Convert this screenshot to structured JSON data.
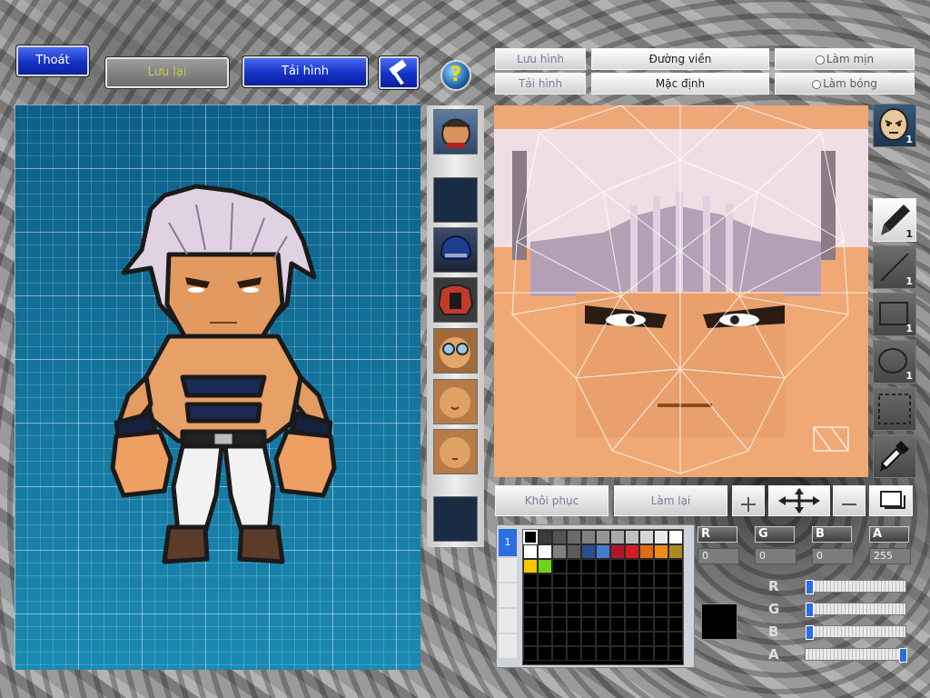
{
  "top_bar": {
    "exit": "Thoát",
    "save": "Lưu lại",
    "reload": "Tải hình",
    "help_symbol": "?"
  },
  "editor_bar": {
    "save": "Lưu hình",
    "reload": "Tải hình",
    "outline": "Đường viền",
    "default": "Mặc định",
    "smooth": "Làm mịn",
    "shade": "Làm bóng"
  },
  "tools": {
    "face_count": "1",
    "pen_count": "1",
    "line_count": "1",
    "rect_count": "1",
    "ellipse_count": "1"
  },
  "bottom_bar": {
    "restore": "Khôi phục",
    "redo": "Làm lại"
  },
  "palette": {
    "layer_index": "1",
    "colors": [
      "#000000",
      "#3a3a3a",
      "#545454",
      "#6a6a6a",
      "#808080",
      "#959595",
      "#aaaaaa",
      "#c0c0c0",
      "#d5d5d5",
      "#eaeaea",
      "#ffffff",
      "#ffffff",
      "#ffffff",
      "#7f7f7f",
      "#5b5b5b",
      "#2a4e8e",
      "#3f7fd0",
      "#b3152b",
      "#d11d1d",
      "#e06b16",
      "#f08a1a",
      "#ad8a20",
      "#f4c800",
      "#6fd21c",
      "#000000"
    ]
  },
  "color_channels": {
    "labels": [
      "R",
      "G",
      "B",
      "A"
    ],
    "values": [
      "0",
      "0",
      "0",
      "255"
    ],
    "slider_levels": [
      0,
      0,
      0,
      1.0
    ]
  },
  "current_color": "#000000"
}
